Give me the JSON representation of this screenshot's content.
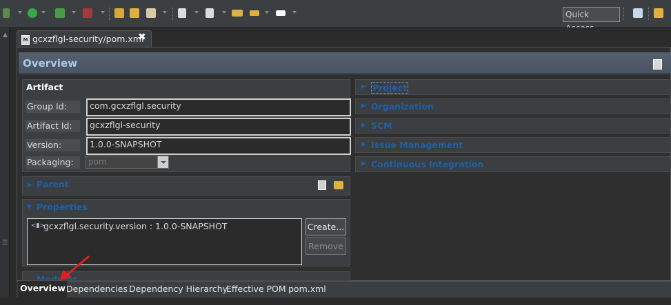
{
  "toolbar": {
    "quick_access": "Quick Access",
    "icons": [
      "debug-icon",
      "run-icon",
      "coverage-icon",
      "external-tools-icon",
      "open-folder-icon",
      "open-folder-icon",
      "pen-icon",
      "document-icon",
      "document-icon",
      "back-history-icon",
      "back-icon",
      "forward-icon"
    ]
  },
  "editor_tab": {
    "title": "gcxzflgl-security/pom.xml",
    "file_icon_text": "M",
    "close": "✖"
  },
  "overview": {
    "title": "Overview"
  },
  "artifact": {
    "title": "Artifact",
    "group_id_label": "Group Id:",
    "group_id": "com.gcxzflgl.security",
    "artifact_id_label": "Artifact Id:",
    "artifact_id": "gcxzflgl-security",
    "version_label": "Version:",
    "version": "1.0.0-SNAPSHOT",
    "packaging_label": "Packaging:",
    "packaging": "pom"
  },
  "parent": {
    "title": "Parent"
  },
  "properties": {
    "title": "Properties",
    "items": [
      "gcxzflgl.security.version : 1.0.0-SNAPSHOT"
    ],
    "create_label": "Create...",
    "remove_label": "Remove"
  },
  "modules": {
    "title": "Modules"
  },
  "right_sections": [
    "Project",
    "Organization",
    "SCM",
    "Issue Management",
    "Continuous Integration"
  ],
  "bottom_tabs": [
    "Overview",
    "Dependencies",
    "Dependency Hierarchy",
    "Effective POM",
    "pom.xml"
  ],
  "colors": {
    "link_blue": "#1e5fa8",
    "header_title": "#a9c9e8",
    "arrow_red": "#e02020"
  }
}
